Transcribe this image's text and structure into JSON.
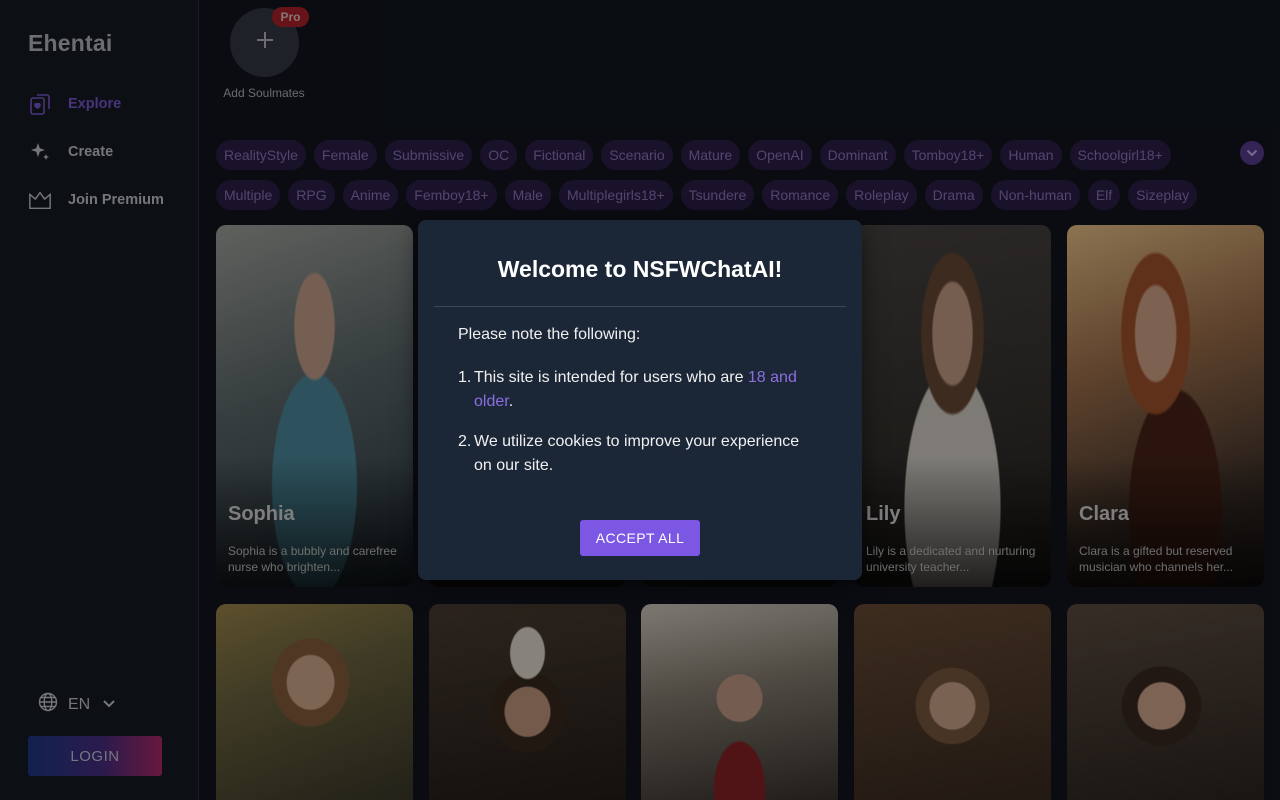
{
  "sidebar": {
    "brand": "Ehentai",
    "items": [
      {
        "label": "Explore",
        "icon": "cards-heart-icon",
        "active": true
      },
      {
        "label": "Create",
        "icon": "sparkle-icon",
        "active": false
      },
      {
        "label": "Join Premium",
        "icon": "crown-icon",
        "active": false
      }
    ],
    "language": "EN",
    "login_label": "LOGIN"
  },
  "add_soulmates": {
    "label": "Add Soulmates",
    "badge": "Pro"
  },
  "tags": {
    "row1": [
      "RealityStyle",
      "Female",
      "Submissive",
      "OC",
      "Fictional",
      "Scenario",
      "Mature",
      "OpenAI",
      "Dominant",
      "Tomboy18+",
      "Human",
      "Schoolgirl18+"
    ],
    "row2": [
      "Multiple",
      "RPG",
      "Anime",
      "Femboy18+",
      "Male",
      "Multiplegirls18+",
      "Tsundere",
      "Romance",
      "Roleplay",
      "Drama",
      "Non-human",
      "Elf",
      "Sizeplay"
    ]
  },
  "cards": [
    {
      "name": "Sophia",
      "desc": "Sophia is a bubbly and carefree nurse who brighten..."
    },
    {
      "name": "",
      "desc": ""
    },
    {
      "name": "",
      "desc": ""
    },
    {
      "name": "Lily",
      "desc": "Lily is a dedicated and nurturing university teacher..."
    },
    {
      "name": "Clara",
      "desc": "Clara is a gifted but reserved musician who channels her..."
    }
  ],
  "modal": {
    "title": "Welcome to NSFWChatAI!",
    "intro": "Please note the following:",
    "item1_prefix": "This site is intended for users who are ",
    "item1_highlight": "18 and older",
    "item1_suffix": ".",
    "item2": "We utilize cookies to improve your experience on our site.",
    "accept_label": "ACCEPT ALL"
  },
  "colors": {
    "accent": "#7b57e4",
    "tag_bg": "#2d1f4b",
    "tag_text": "#8e79c0",
    "pro_badge": "#b0242b"
  }
}
